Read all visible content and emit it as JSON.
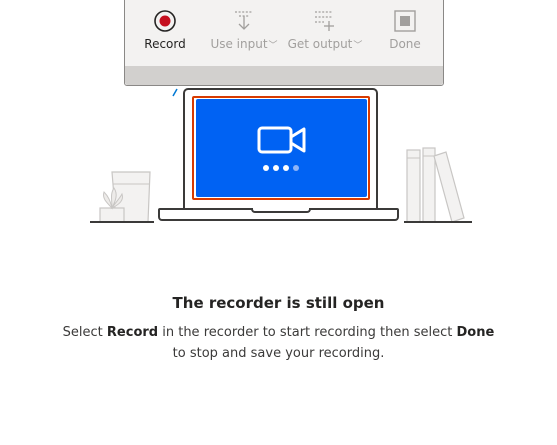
{
  "toolbar": {
    "record_label": "Record",
    "use_input_label": "Use input",
    "get_output_label": "Get output",
    "done_label": "Done"
  },
  "illustration": {
    "screen_color": "#0062f3",
    "frame_accent": "#d83b01",
    "record_color": "#c50f1f",
    "camera_icon": "video-camera-icon",
    "progress_dots": 4
  },
  "message": {
    "title": "The recorder is still open",
    "line1_pre": "Select ",
    "line1_record": "Record",
    "line1_mid": " in the recorder to start recording then select ",
    "line1_done": "Done",
    "line2": "to stop and save your recording."
  }
}
